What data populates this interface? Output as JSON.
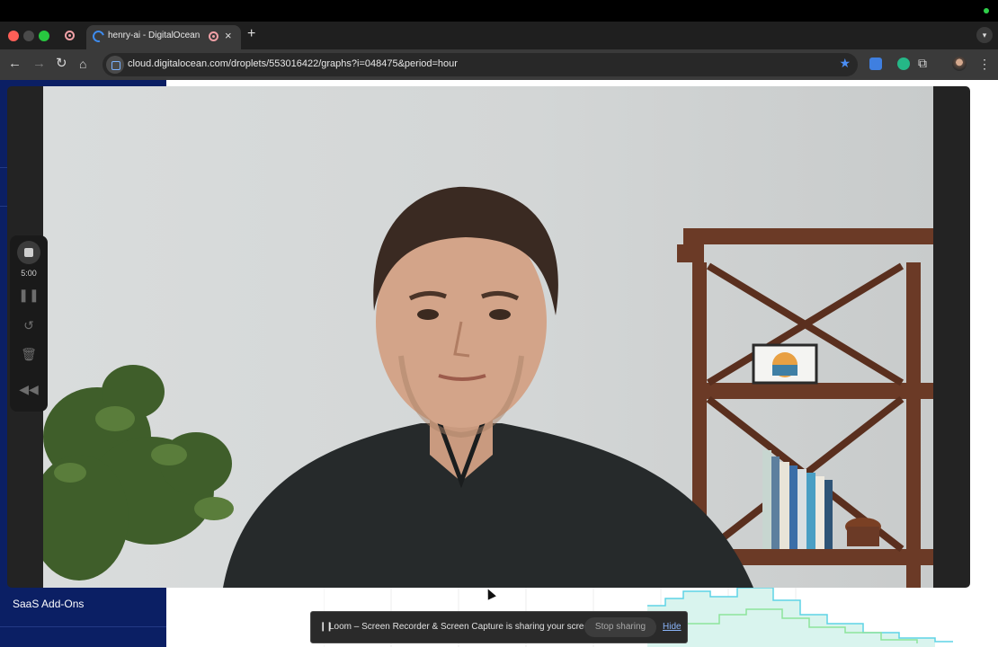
{
  "browser": {
    "tab_title": "henry-ai - DigitalOcean",
    "tab_close": "×",
    "new_tab": "+",
    "url": "cloud.digitalocean.com/droplets/553016422/graphs?i=048475&period=hour",
    "icons": [
      "back-icon",
      "forward-icon",
      "reload-icon",
      "home-icon",
      "star-icon",
      "extensions-icon",
      "menu-icon"
    ]
  },
  "sidebar": {
    "bottom_item": "SaaS Add-Ons",
    "background": "#0b1f64"
  },
  "loom_controls": {
    "timer": "5:00",
    "icons": [
      "stop-icon",
      "pause-icon",
      "restart-icon",
      "trash-icon",
      "rewind-icon"
    ]
  },
  "share_bar": {
    "message": "Loom – Screen Recorder & Screen Capture is sharing your screen.",
    "stop_label": "Stop sharing",
    "hide_label": "Hide"
  },
  "colors": {
    "accent_blue": "#4b8ef5",
    "chart_cyan": "#5fd3e6",
    "chart_green": "#8ee39b"
  }
}
